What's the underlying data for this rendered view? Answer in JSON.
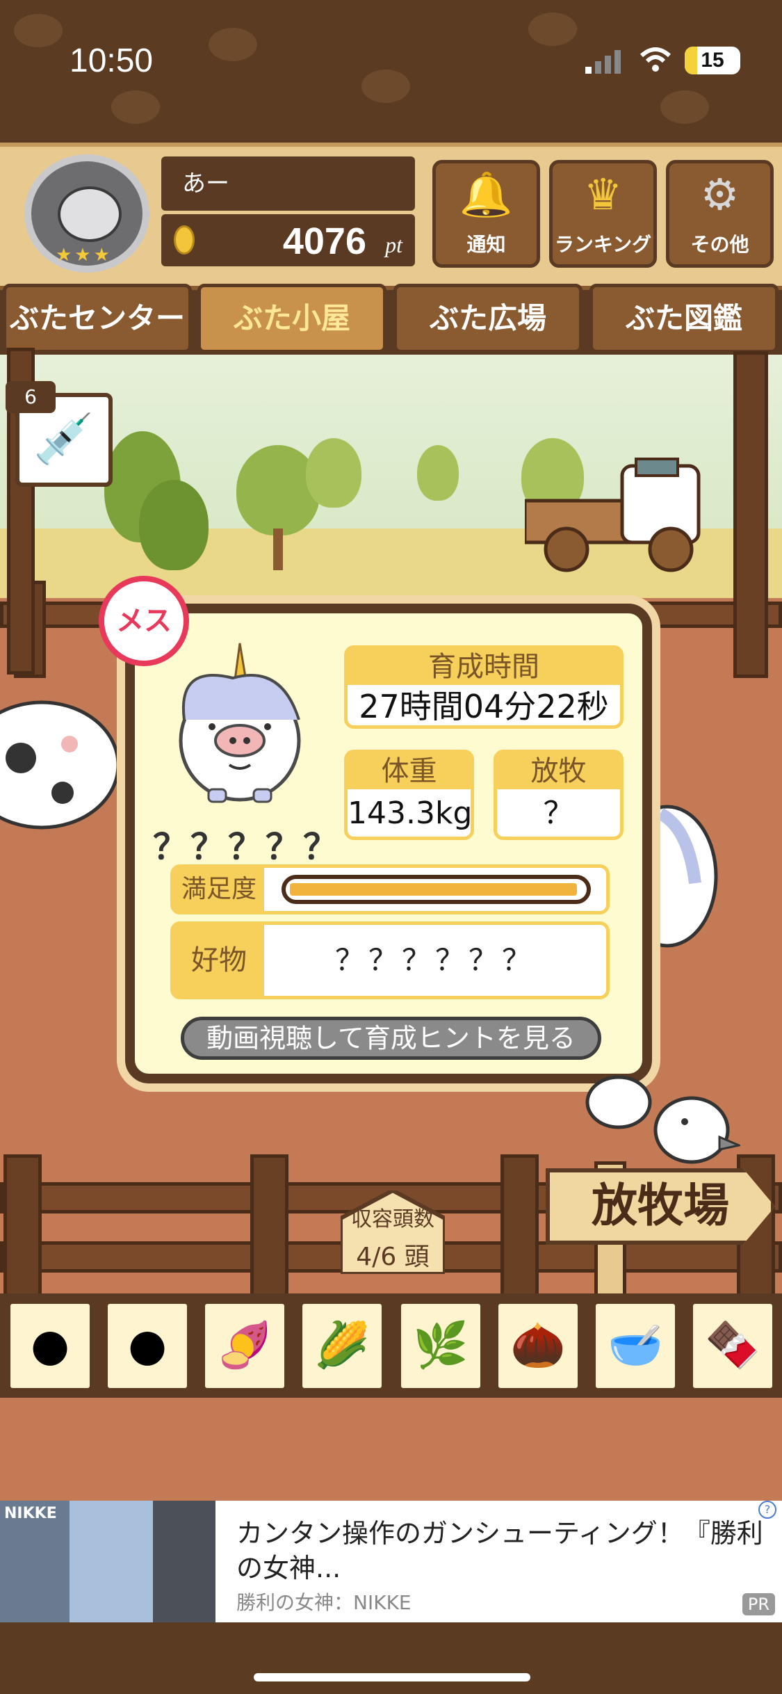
{
  "status_bar": {
    "time": "10:50",
    "battery": "15"
  },
  "header": {
    "user_name": "あー",
    "points": "4076",
    "points_unit": "pt",
    "buttons": [
      {
        "label": "通知",
        "icon": "bell-icon"
      },
      {
        "label": "ランキング",
        "icon": "crown-icon"
      },
      {
        "label": "その他",
        "icon": "gear-icon"
      }
    ]
  },
  "tabs": [
    {
      "label": "ぶたセンター",
      "active": false
    },
    {
      "label": "ぶた小屋",
      "active": true
    },
    {
      "label": "ぶた広場",
      "active": false
    },
    {
      "label": "ぶた図鑑",
      "active": false
    }
  ],
  "item": {
    "syringe_count": "6"
  },
  "pig_card": {
    "sex_label": "メス",
    "name": "？？？？？",
    "raise_time_label": "育成時間",
    "raise_time_value": "27時間04分22秒",
    "weight_label": "体重",
    "weight_value": "143.3kg",
    "graze_label": "放牧",
    "graze_value": "？",
    "satisfaction_label": "満足度",
    "satisfaction_level": 0.98,
    "favorite_label": "好物",
    "favorite_value": "？？？？？？",
    "video_button": "動画視聴して育成ヒントを見る"
  },
  "field": {
    "capacity_label": "収容頭数",
    "capacity_value": "4/6 頭",
    "pasture_sign": "放牧場"
  },
  "ad": {
    "title": "カンタン操作のガンシューティング！『勝利の女神...",
    "advertiser": "勝利の女神：NIKKE",
    "brand": "NIKKE",
    "badge": "PR",
    "info": "?"
  },
  "colors": {
    "wood_dark": "#5a3a22",
    "wood": "#8a5a30",
    "card_bg": "#fffbd0",
    "label_yellow": "#f6d05a",
    "female_pink": "#e8395a",
    "ground": "#c47a55"
  }
}
